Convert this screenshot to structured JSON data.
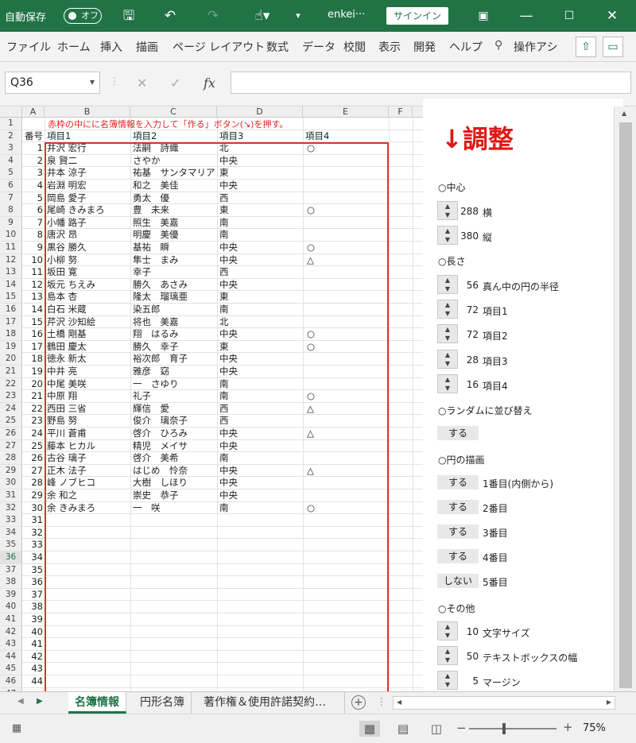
{
  "titlebar": {
    "autosave_label": "自動保存",
    "autosave_state": "オフ",
    "filename": "enkei···",
    "signin_label": "サインイン",
    "icons": [
      "save-icon",
      "undo-icon",
      "redo-icon",
      "touch-mode-icon",
      "customize-icon",
      "ribbon-display-icon",
      "minimize-icon",
      "maximize-icon",
      "close-icon"
    ]
  },
  "menu": {
    "items": [
      "ファイル",
      "ホーム",
      "挿入",
      "描画",
      "ページ レイアウト",
      "数式",
      "データ",
      "校閲",
      "表示",
      "開発",
      "ヘルプ"
    ],
    "search": "操作アシ"
  },
  "formula_bar": {
    "namebox": "Q36",
    "fx_label": "fx",
    "formula": ""
  },
  "columns": [
    "",
    "A",
    "B",
    "C",
    "D",
    "E",
    "F"
  ],
  "sheet": {
    "note": "赤枠の中にに名簿情報を入力して「作る」ボタン(↘)を押す。",
    "headers": [
      "番号",
      "項目1",
      "項目2",
      "項目3",
      "項目4"
    ],
    "rows": [
      [
        "1",
        "井沢 宏行",
        "法嗣　詩織",
        "北",
        "○"
      ],
      [
        "2",
        "泉 賢二",
        "さやか",
        "中央",
        ""
      ],
      [
        "3",
        "井本 涼子",
        "祐基　サンタマリア",
        "東",
        ""
      ],
      [
        "4",
        "岩淵 明宏",
        "和之　美佳",
        "中央",
        ""
      ],
      [
        "5",
        "岡島 愛子",
        "勇太　優",
        "西",
        ""
      ],
      [
        "6",
        "尾崎 きみまろ",
        "豊　未来",
        "東",
        "○"
      ],
      [
        "7",
        "小幡 路子",
        "照生　美嘉",
        "南",
        ""
      ],
      [
        "8",
        "唐沢 昂",
        "明慶　美優",
        "南",
        ""
      ],
      [
        "9",
        "黒谷 勝久",
        "基祐　瞬",
        "中央",
        "○"
      ],
      [
        "10",
        "小柳 努",
        "隼士　まみ",
        "中央",
        "△"
      ],
      [
        "11",
        "坂田 寛",
        "幸子",
        "西",
        ""
      ],
      [
        "12",
        "坂元 ちえみ",
        "勝久　あさみ",
        "中央",
        ""
      ],
      [
        "13",
        "島本 杏",
        "隆太　瑠璃亜",
        "東",
        ""
      ],
      [
        "14",
        "白石 米蔵",
        "染五郎",
        "南",
        ""
      ],
      [
        "15",
        "芹沢 沙知絵",
        "将也　美嘉",
        "北",
        ""
      ],
      [
        "16",
        "土橋 剛基",
        "翔　はるみ",
        "中央",
        "○"
      ],
      [
        "17",
        "鶴田 慶太",
        "勝久　幸子",
        "東",
        "○"
      ],
      [
        "18",
        "徳永 新太",
        "裕次郎　育子",
        "中央",
        ""
      ],
      [
        "19",
        "中井 亮",
        "雅彦　窈",
        "中央",
        ""
      ],
      [
        "20",
        "中尾 美咲",
        "一　さゆり",
        "南",
        ""
      ],
      [
        "21",
        "中原 翔",
        "礼子",
        "南",
        "○"
      ],
      [
        "22",
        "西田 三省",
        "輝信　愛",
        "西",
        "△"
      ],
      [
        "23",
        "野島 努",
        "俊介　璃奈子",
        "西",
        ""
      ],
      [
        "24",
        "平川 蒼甫",
        "啓介　ひろみ",
        "中央",
        "△"
      ],
      [
        "25",
        "藤本 ヒカル",
        "精児　メイサ",
        "中央",
        ""
      ],
      [
        "26",
        "古谷 璃子",
        "啓介　美希",
        "南",
        ""
      ],
      [
        "27",
        "正木 法子",
        "はじめ　怜奈",
        "中央",
        "△"
      ],
      [
        "28",
        "峰 ノブヒコ",
        "大樹　しほり",
        "中央",
        ""
      ],
      [
        "29",
        "余 和之",
        "崇史　恭子",
        "中央",
        ""
      ],
      [
        "30",
        "余 きみまろ",
        "一　咲",
        "南",
        "○"
      ],
      [
        "31",
        "",
        "",
        "",
        ""
      ],
      [
        "32",
        "",
        "",
        "",
        ""
      ],
      [
        "33",
        "",
        "",
        "",
        ""
      ],
      [
        "34",
        "",
        "",
        "",
        ""
      ],
      [
        "35",
        "",
        "",
        "",
        ""
      ],
      [
        "36",
        "",
        "",
        "",
        ""
      ],
      [
        "37",
        "",
        "",
        "",
        ""
      ],
      [
        "38",
        "",
        "",
        "",
        ""
      ],
      [
        "39",
        "",
        "",
        "",
        ""
      ],
      [
        "40",
        "",
        "",
        "",
        ""
      ],
      [
        "41",
        "",
        "",
        "",
        ""
      ],
      [
        "42",
        "",
        "",
        "",
        ""
      ],
      [
        "43",
        "",
        "",
        "",
        ""
      ],
      [
        "44",
        "",
        "",
        "",
        ""
      ]
    ],
    "row_numbers": [
      "1",
      "2",
      "3",
      "4",
      "5",
      "6",
      "7",
      "8",
      "9",
      "10",
      "11",
      "12",
      "13",
      "14",
      "15",
      "16",
      "17",
      "18",
      "19",
      "20",
      "21",
      "22",
      "23",
      "24",
      "25",
      "26",
      "27",
      "28",
      "29",
      "30",
      "31",
      "32",
      "33",
      "34",
      "35",
      "36",
      "37",
      "38",
      "39",
      "40",
      "41",
      "42",
      "43",
      "44",
      "45",
      "46",
      "47"
    ]
  },
  "panel": {
    "title": "↓調整",
    "center_label": "○中心",
    "horiz": {
      "value": "288",
      "label": "横"
    },
    "vert": {
      "value": "380",
      "label": "縦"
    },
    "length_label": "○長さ",
    "radius": {
      "value": "56",
      "label": "真ん中の円の半径"
    },
    "item1": {
      "value": "72",
      "label": "項目1"
    },
    "item2": {
      "value": "72",
      "label": "項目2"
    },
    "item3": {
      "value": "28",
      "label": "項目3"
    },
    "item4": {
      "value": "16",
      "label": "項目4"
    },
    "shuffle_label": "○ランダムに並び替え",
    "shuffle_btn": "する",
    "draw_label": "○円の描画",
    "draw_rows": [
      {
        "btn": "する",
        "label": "1番目(内側から)"
      },
      {
        "btn": "する",
        "label": "2番目"
      },
      {
        "btn": "する",
        "label": "3番目"
      },
      {
        "btn": "する",
        "label": "4番目"
      },
      {
        "btn": "しない",
        "label": "5番目"
      }
    ],
    "other_label": "○その他",
    "fontsize": {
      "value": "10",
      "label": "文字サイズ"
    },
    "textbox": {
      "value": "50",
      "label": "テキストボックスの幅"
    },
    "margin": {
      "value": "5",
      "label": "マージン"
    }
  },
  "tabs": {
    "items": [
      "名簿情報",
      "円形名簿",
      "著作権＆使用許諾契約…"
    ],
    "active": "名簿情報"
  },
  "status": {
    "zoom": "75%"
  }
}
